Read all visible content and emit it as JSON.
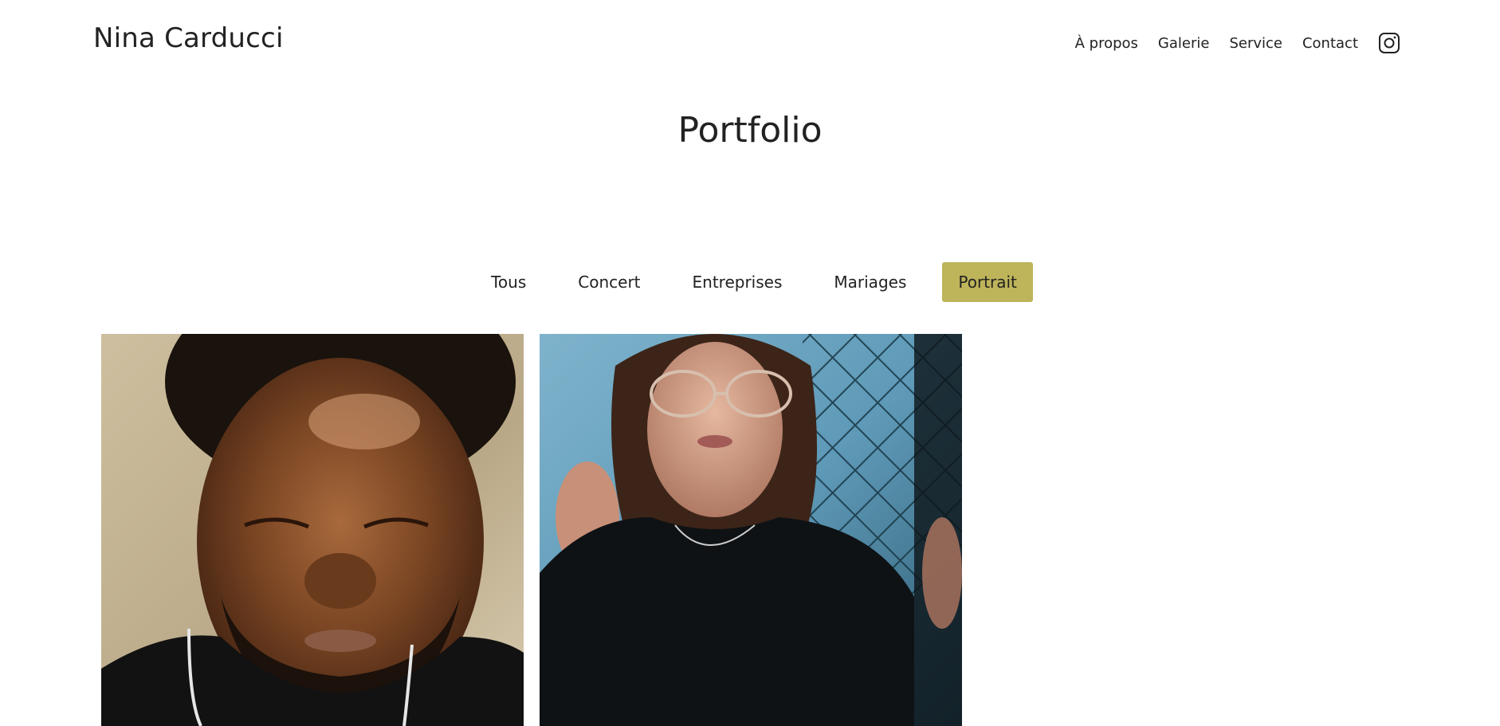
{
  "brand": {
    "name": "Nina Carducci"
  },
  "nav": {
    "items": [
      {
        "label": "À propos"
      },
      {
        "label": "Galerie"
      },
      {
        "label": "Service"
      },
      {
        "label": "Contact"
      }
    ],
    "social_icon": "instagram-icon"
  },
  "page": {
    "title": "Portfolio"
  },
  "filters": {
    "items": [
      {
        "label": "Tous",
        "active": false
      },
      {
        "label": "Concert",
        "active": false
      },
      {
        "label": "Entreprises",
        "active": false
      },
      {
        "label": "Mariages",
        "active": false
      },
      {
        "label": "Portrait",
        "active": true
      }
    ],
    "active_color": "#BEB45A"
  },
  "gallery": {
    "images": [
      {
        "subject": "man-with-closed-eyes-portrait"
      },
      {
        "subject": "woman-with-glasses-portrait"
      }
    ]
  }
}
